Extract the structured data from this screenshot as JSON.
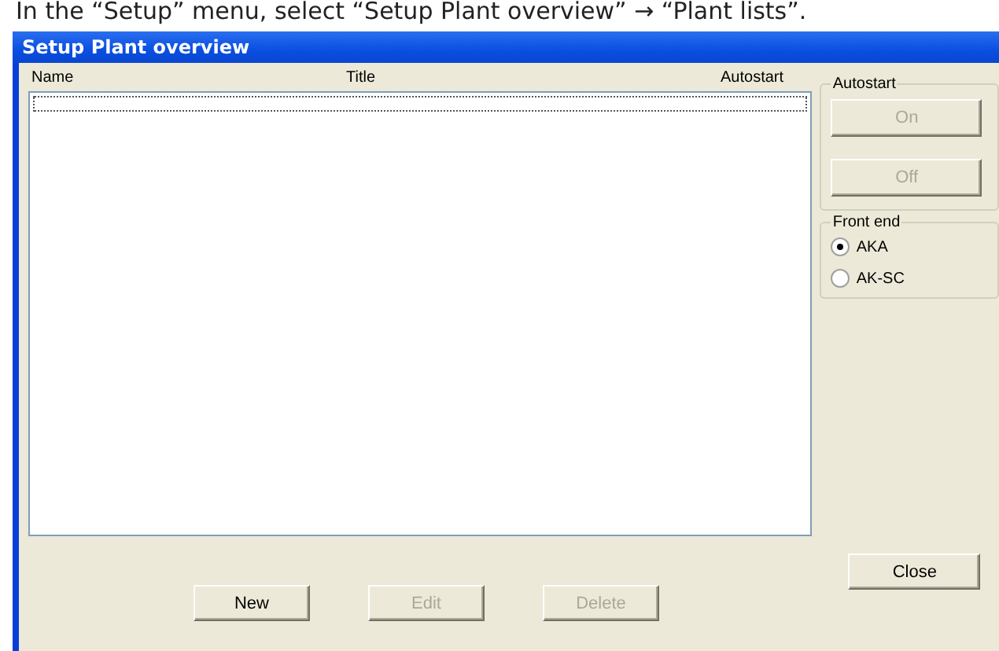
{
  "caption": "In the “Setup” menu, select “Setup Plant overview” → “Plant lists”.",
  "window": {
    "title": "Setup Plant overview"
  },
  "table": {
    "columns": [
      "Name",
      "Title",
      "Autostart"
    ]
  },
  "autostart_group": {
    "label": "Autostart",
    "buttons": [
      {
        "label": "On",
        "disabled": true
      },
      {
        "label": "Off",
        "disabled": true
      }
    ]
  },
  "front_end_group": {
    "label": "Front end",
    "options": [
      {
        "label": "AKA",
        "selected": true
      },
      {
        "label": "AK-SC",
        "selected": false
      }
    ]
  },
  "close_button": {
    "label": "Close",
    "disabled": false
  },
  "bottom_buttons": [
    {
      "label": "New",
      "disabled": false
    },
    {
      "label": "Edit",
      "disabled": true
    },
    {
      "label": "Delete",
      "disabled": true
    }
  ]
}
